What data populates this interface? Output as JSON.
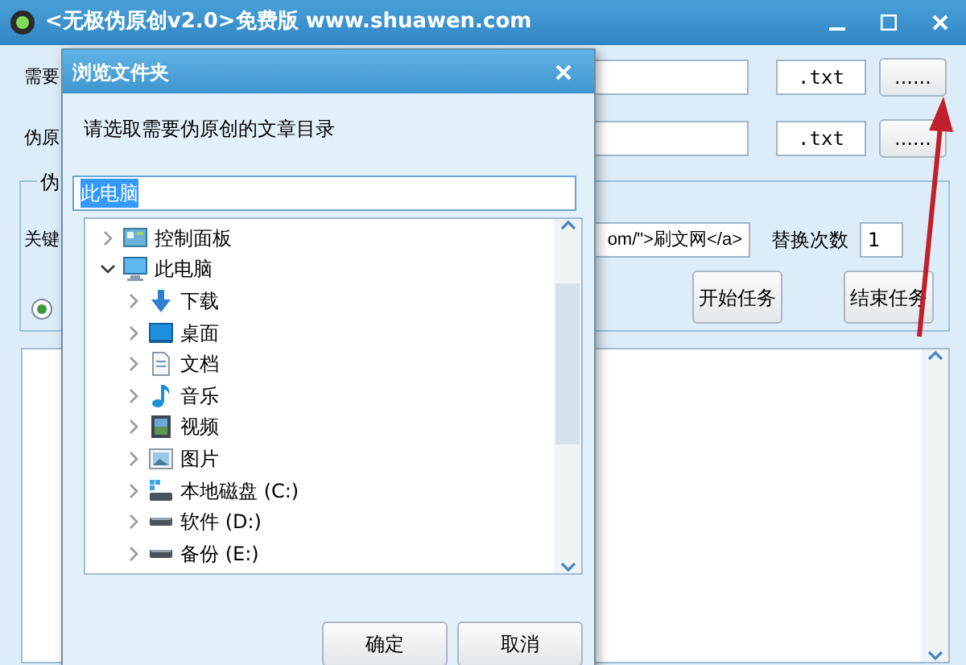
{
  "window": {
    "title": "<无极伪原创v2.0>免费版 www.shuawen.com"
  },
  "main": {
    "rows": [
      {
        "label": "需要",
        "extension": ".txt",
        "browse": "......"
      },
      {
        "label": "伪原",
        "extension": ".txt",
        "browse": "......"
      }
    ],
    "group": {
      "title": "伪",
      "keyword_label": "关键",
      "keyword_value": "om/\">刷文网</a>",
      "replace_label": "替换次数",
      "replace_value": "1",
      "radio": {
        "selected": true
      },
      "buttons": [
        "开始任务",
        "结束任务"
      ]
    }
  },
  "dialog": {
    "title": "浏览文件夹",
    "prompt": "请选取需要伪原创的文章目录",
    "path": {
      "value": "此电脑",
      "selected": true
    },
    "tree": [
      {
        "label": "控制面板",
        "kind": "control-panel",
        "expanded": false
      },
      {
        "label": "此电脑",
        "kind": "computer",
        "expanded": true,
        "children": [
          {
            "label": "下载",
            "kind": "download",
            "expanded": false
          },
          {
            "label": "桌面",
            "kind": "desktop",
            "expanded": false
          },
          {
            "label": "文档",
            "kind": "documents",
            "expanded": false
          },
          {
            "label": "音乐",
            "kind": "music",
            "expanded": false
          },
          {
            "label": "视频",
            "kind": "videos",
            "expanded": false
          },
          {
            "label": "图片",
            "kind": "pictures",
            "expanded": false
          },
          {
            "label": "本地磁盘 (C:)",
            "kind": "system-drive",
            "expanded": false
          },
          {
            "label": "软件 (D:)",
            "kind": "drive",
            "expanded": false
          },
          {
            "label": "备份 (E:)",
            "kind": "drive",
            "expanded": false
          }
        ]
      }
    ],
    "buttons": [
      "确定",
      "取消"
    ]
  }
}
